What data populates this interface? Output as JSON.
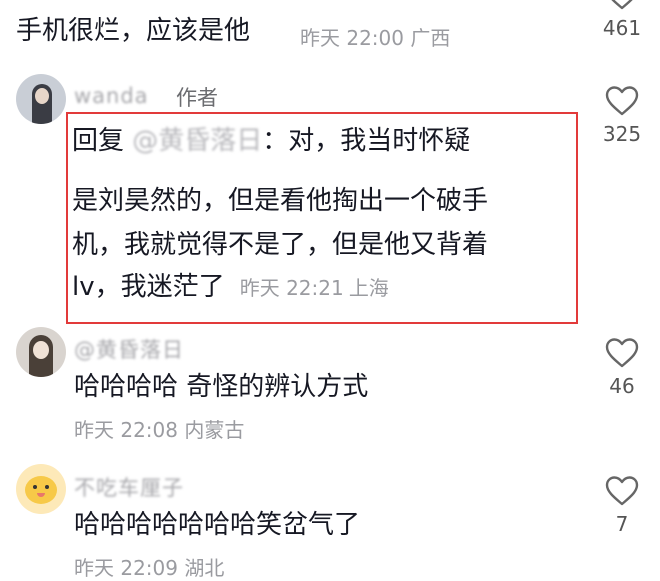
{
  "colors": {
    "highlight": "#e23a3a",
    "meta": "#9a9ba0",
    "text": "#161823"
  },
  "comments": [
    {
      "text": "手机很烂，应该是他",
      "time": "昨天 22:00",
      "location": "广西",
      "likes": "461"
    },
    {
      "user": "wanda",
      "author_tag": "作者",
      "reply_prefix": "回复",
      "mention": "@黄昏落日",
      "line1_rest": "：对，我当时怀疑",
      "line2": "是刘昊然的，但是看他掏出一个破手",
      "line3": "机，我就觉得不是了，但是他又背着",
      "line4": "lv，我迷茫了",
      "time": "昨天 22:21",
      "location": "上海",
      "likes": "325"
    },
    {
      "user": "@黄昏落日",
      "text": "哈哈哈哈 奇怪的辨认方式",
      "time": "昨天 22:08",
      "location": "内蒙古",
      "likes": "46"
    },
    {
      "user": "不吃车厘子",
      "text": "哈哈哈哈哈哈哈笑岔气了",
      "time": "昨天 22:09",
      "location": "湖北",
      "likes": "7"
    }
  ]
}
